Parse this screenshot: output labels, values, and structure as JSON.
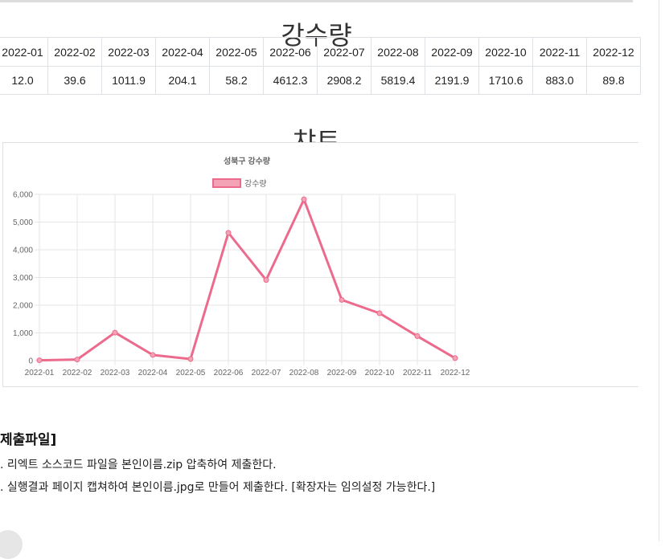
{
  "page": {
    "title": "강수량",
    "chart_section_title": "챠트"
  },
  "table": {
    "headers": [
      "2022-01",
      "2022-02",
      "2022-03",
      "2022-04",
      "2022-05",
      "2022-06",
      "2022-07",
      "2022-08",
      "2022-09",
      "2022-10",
      "2022-11",
      "2022-12"
    ],
    "values": [
      "12.0",
      "39.6",
      "1011.9",
      "204.1",
      "58.2",
      "4612.3",
      "2908.2",
      "5819.4",
      "2191.9",
      "1710.6",
      "883.0",
      "89.8"
    ]
  },
  "chart_data": {
    "type": "line",
    "title": "성북구 강수량",
    "legend_position": "top",
    "categories": [
      "2022-01",
      "2022-02",
      "2022-03",
      "2022-04",
      "2022-05",
      "2022-06",
      "2022-07",
      "2022-08",
      "2022-09",
      "2022-10",
      "2022-11",
      "2022-12"
    ],
    "series": [
      {
        "name": "강수량",
        "values": [
          12.0,
          39.6,
          1011.9,
          204.1,
          58.2,
          4612.3,
          2908.2,
          5819.4,
          2191.9,
          1710.6,
          883.0,
          89.8
        ]
      }
    ],
    "ylim": [
      0,
      6000
    ],
    "yticks": [
      "0",
      "1,000",
      "2,000",
      "3,000",
      "4,000",
      "5,000",
      "6,000"
    ],
    "grid": true,
    "line_color": "#ec6b8c",
    "fill_color": "#f4a3b6"
  },
  "submission": {
    "heading": "제출파일]",
    "items": [
      ". 리엑트 소스코드 파일을 본인이름.zip 압축하여 제출한다.",
      ". 실행결과 페이지 캡쳐하여 본인이름.jpg로 만들어 제출한다. [확장자는 임의설정 가능한다.]"
    ]
  }
}
